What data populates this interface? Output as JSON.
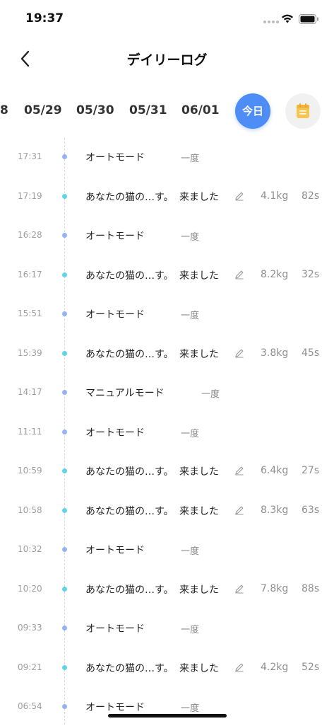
{
  "status_bar": {
    "time": "19:37"
  },
  "nav": {
    "title": "デイリーログ"
  },
  "dates": [
    {
      "label": "8"
    },
    {
      "label": "05/29"
    },
    {
      "label": "05/30"
    },
    {
      "label": "05/31"
    },
    {
      "label": "06/01"
    }
  ],
  "today_label": "今日",
  "colors": {
    "accent": "#4e8cf6",
    "mode_dot": "#94b3f7",
    "visit_dot": "#5fd6e6",
    "calendar_icon": "#f5c451"
  },
  "logs": [
    {
      "time": "17:31",
      "type": "mode",
      "title": "オートモード",
      "status": "一度"
    },
    {
      "time": "17:19",
      "type": "visit",
      "title": "あなたの猫の…す。",
      "arrived": "来ました",
      "weight": "4.1kg",
      "duration": "82s"
    },
    {
      "time": "16:28",
      "type": "mode",
      "title": "オートモード",
      "status": "一度"
    },
    {
      "time": "16:17",
      "type": "visit",
      "title": "あなたの猫の…す。",
      "arrived": "来ました",
      "weight": "8.2kg",
      "duration": "32s"
    },
    {
      "time": "15:51",
      "type": "mode",
      "title": "オートモード",
      "status": "一度"
    },
    {
      "time": "15:39",
      "type": "visit",
      "title": "あなたの猫の…す。",
      "arrived": "来ました",
      "weight": "3.8kg",
      "duration": "45s"
    },
    {
      "time": "14:17",
      "type": "mode",
      "title": "マニュアルモード",
      "status": "一度"
    },
    {
      "time": "11:11",
      "type": "mode",
      "title": "オートモード",
      "status": "一度"
    },
    {
      "time": "10:59",
      "type": "visit",
      "title": "あなたの猫の…す。",
      "arrived": "来ました",
      "weight": "6.4kg",
      "duration": "27s"
    },
    {
      "time": "10:58",
      "type": "visit",
      "title": "あなたの猫の…す。",
      "arrived": "来ました",
      "weight": "8.3kg",
      "duration": "63s"
    },
    {
      "time": "10:32",
      "type": "mode",
      "title": "オートモード",
      "status": "一度"
    },
    {
      "time": "10:20",
      "type": "visit",
      "title": "あなたの猫の…す。",
      "arrived": "来ました",
      "weight": "7.8kg",
      "duration": "88s"
    },
    {
      "time": "09:33",
      "type": "mode",
      "title": "オートモード",
      "status": "一度"
    },
    {
      "time": "09:21",
      "type": "visit",
      "title": "あなたの猫の…す。",
      "arrived": "来ました",
      "weight": "4.2kg",
      "duration": "52s"
    },
    {
      "time": "06:54",
      "type": "mode",
      "title": "オートモード",
      "status": "一度"
    }
  ]
}
